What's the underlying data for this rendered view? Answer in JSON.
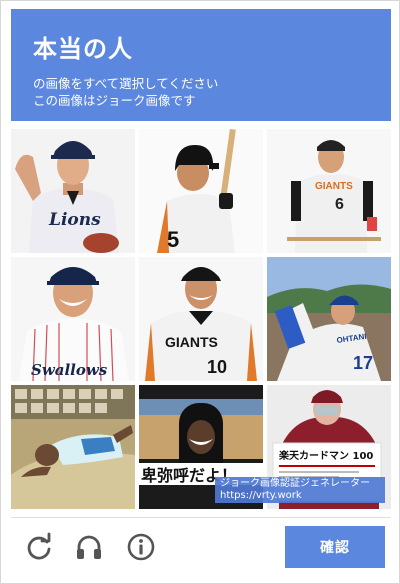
{
  "header": {
    "title": "本当の人",
    "instruction_line1": "の画像をすべて選択してください",
    "instruction_line2": "この画像はジョーク画像です"
  },
  "tiles": [
    {
      "name": "tile-1",
      "jersey_text": "Lions",
      "number": ""
    },
    {
      "name": "tile-2",
      "jersey_text": "",
      "number": "5"
    },
    {
      "name": "tile-3",
      "jersey_text": "GIANTS",
      "number": "6"
    },
    {
      "name": "tile-4",
      "jersey_text": "Swallows",
      "number": ""
    },
    {
      "name": "tile-5",
      "jersey_text": "GIANTS",
      "number": "10"
    },
    {
      "name": "tile-6",
      "jersey_text": "OHTANI",
      "number": "17"
    },
    {
      "name": "tile-7",
      "jersey_text": "",
      "number": ""
    },
    {
      "name": "tile-8",
      "caption": "卑弥呼だよ！",
      "number": ""
    },
    {
      "name": "tile-9",
      "card_title": "楽天カードマン 100",
      "number": ""
    }
  ],
  "watermark": {
    "line1": "ジョーク画像認証ジェネレーター",
    "line2": "https://vrty.work"
  },
  "footer": {
    "confirm_label": "確認",
    "icons": [
      "reload-icon",
      "headphones-icon",
      "info-icon"
    ]
  },
  "colors": {
    "accent": "#5b87de",
    "icon_gray": "#555555"
  }
}
